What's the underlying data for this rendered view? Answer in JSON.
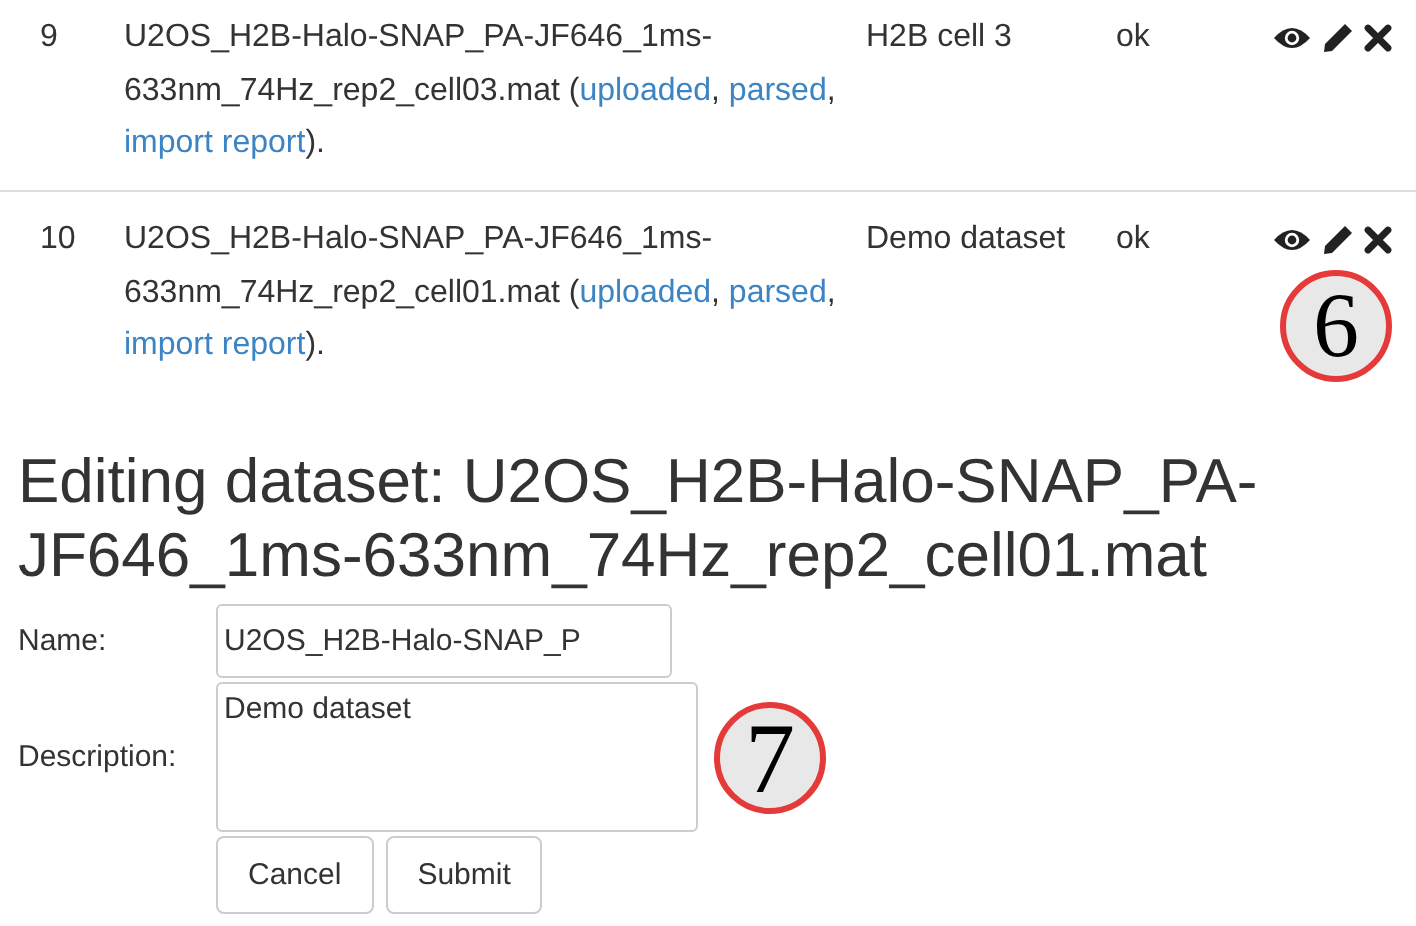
{
  "rows": [
    {
      "index": "9",
      "file": [
        {
          "kind": "text",
          "text": "U2OS_H2B-Halo-SNAP_PA-JF646_1ms-633nm_74Hz_rep2_cell03.mat ("
        },
        {
          "kind": "link",
          "text": "uploaded"
        },
        {
          "kind": "text",
          "text": ", "
        },
        {
          "kind": "link",
          "text": "parsed"
        },
        {
          "kind": "text",
          "text": ", "
        },
        {
          "kind": "link",
          "text": "import report"
        },
        {
          "kind": "text",
          "text": ")."
        }
      ],
      "description": "H2B cell 3",
      "status": "ok"
    },
    {
      "index": "10",
      "file": [
        {
          "kind": "text",
          "text": "U2OS_H2B-Halo-SNAP_PA-JF646_1ms-633nm_74Hz_rep2_cell01.mat ("
        },
        {
          "kind": "link",
          "text": "uploaded"
        },
        {
          "kind": "text",
          "text": ", "
        },
        {
          "kind": "link",
          "text": "parsed"
        },
        {
          "kind": "text",
          "text": ", "
        },
        {
          "kind": "link",
          "text": "import report"
        },
        {
          "kind": "text",
          "text": ")."
        }
      ],
      "description": "Demo dataset",
      "status": "ok",
      "callout": "6"
    }
  ],
  "editor": {
    "title": "Editing dataset: U2OS_H2B-Halo-SNAP_PA-JF646_1ms-633nm_74Hz_rep2_cell01.mat",
    "name_label": "Name:",
    "name_value": "U2OS_H2B-Halo-SNAP_P",
    "description_label": "Description:",
    "description_value": "Demo dataset",
    "callout": "7",
    "buttons": [
      "Cancel",
      "Submit"
    ]
  }
}
